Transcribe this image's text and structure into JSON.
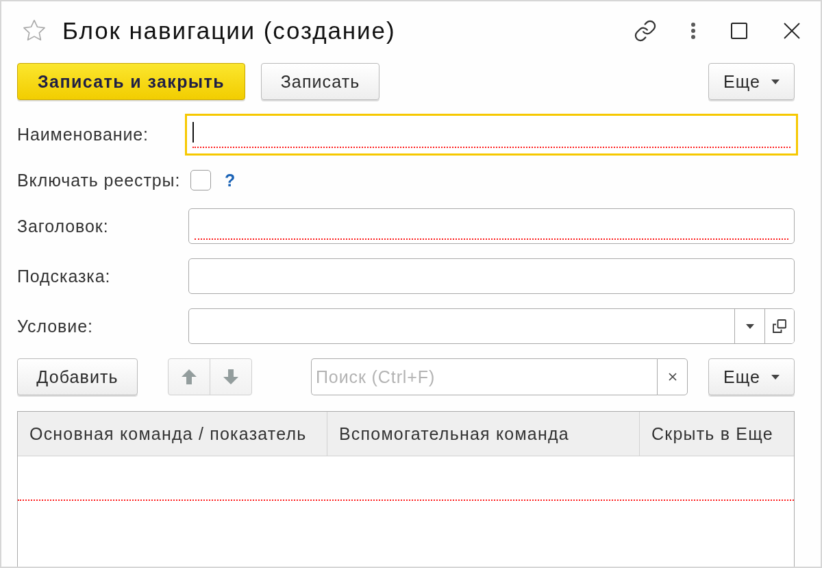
{
  "window": {
    "title": "Блок навигации (создание)",
    "favorite": false
  },
  "command_bar": {
    "buttons": [
      {
        "label": "Записать и закрыть",
        "kind": "primary"
      },
      {
        "label": "Записать",
        "kind": "default"
      }
    ],
    "more": {
      "label": "Еще"
    }
  },
  "fields": [
    {
      "kind": "text",
      "label": "Наименование:",
      "focused": true,
      "required": true
    },
    {
      "kind": "checkbox",
      "label": "Включать реестры:",
      "checked": false,
      "help": "?"
    },
    {
      "kind": "text",
      "label": "Заголовок:",
      "focused": false,
      "required": true
    },
    {
      "kind": "text",
      "label": "Подсказка:",
      "focused": false,
      "required": false
    },
    {
      "kind": "select",
      "label": "Условие:",
      "focused": false,
      "required": false
    }
  ],
  "table_toolbar": {
    "add": {
      "label": "Добавить"
    },
    "move_buttons": [
      {
        "kind": "up",
        "disabled": true
      },
      {
        "kind": "down",
        "disabled": true
      }
    ],
    "search": {
      "placeholder": "Поиск (Ctrl+F)"
    },
    "more": {
      "label": "Еще"
    }
  },
  "table": {
    "columns": [
      "Основная команда / показатель",
      "Вспомогательная команда",
      "Скрыть в Еще"
    ],
    "required": true
  }
}
